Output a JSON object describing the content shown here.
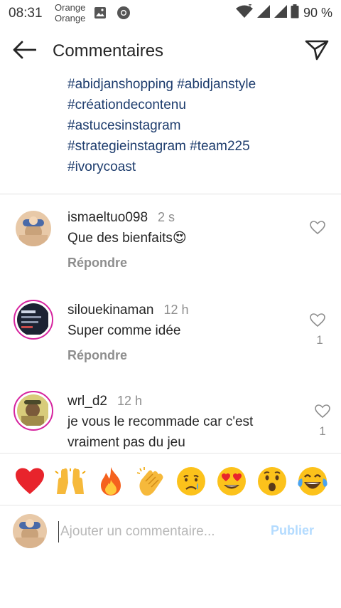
{
  "status_bar": {
    "time": "08:31",
    "carrier_line1": "Orange",
    "carrier_line2": "Orange",
    "battery": "90 %"
  },
  "header": {
    "title": "Commentaires"
  },
  "caption": {
    "lines": [
      "#abidjanshopping #abidjanstyle",
      "#créationdecontenu",
      "#astucesinstagram",
      "#strategieinstagram #team225",
      "#ivorycoast"
    ]
  },
  "comments": [
    {
      "username": "ismaeltuo098",
      "time": "2 s",
      "text": "Que des bienfaits😍",
      "reply_label": "Répondre",
      "likes": ""
    },
    {
      "username": "silouekinaman",
      "time": "12 h",
      "text": "Super comme idée",
      "reply_label": "Répondre",
      "likes": "1"
    },
    {
      "username": "wrl_d2",
      "time": "12 h",
      "text": "je vous le recommade car c'est vraiment pas du jeu",
      "reply_label": "",
      "likes": "1"
    }
  ],
  "emoji_bar": [
    "❤️",
    "🙌",
    "🔥",
    "👏",
    "😢",
    "😍",
    "😮",
    "😂"
  ],
  "compose": {
    "placeholder": "Ajouter un commentaire...",
    "post_label": "Publier"
  },
  "colors": {
    "hashtag": "#1d3c6d",
    "ring": "#d6249f",
    "post_disabled": "#b3dbff",
    "muted": "#8e8e8e"
  }
}
